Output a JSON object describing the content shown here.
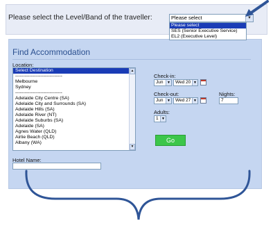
{
  "level": {
    "label": "Please select the Level/Band of the traveller:",
    "selected": "Please select",
    "options": [
      "Please select",
      "SES (Senior Executive Service)",
      "EL2 (Executive Level)"
    ]
  },
  "find": {
    "title": "Find Accommodation",
    "location_label": "Location:",
    "locations": [
      "Select Destination",
      "------------------------------",
      "Melbourne",
      "Sydney",
      "------------------------------",
      "Adelaide City Centre (SA)",
      "Adelaide City and Surrounds (SA)",
      "Adelaide Hills (SA)",
      "Adelaide River (NT)",
      "Adelaide Suburbs (SA)",
      "Adelaide (SA)",
      "Agnes Water (QLD)",
      "Airlie Beach (QLD)",
      "Albany (WA)"
    ],
    "hotel_label": "Hotel Name:",
    "checkin_label": "Check-in:",
    "checkin_month": "Jun",
    "checkin_day": "Wed 20",
    "checkout_label": "Check-out:",
    "checkout_month": "Jun",
    "checkout_day": "Wed 27",
    "nights_label": "Nights:",
    "nights_value": "7",
    "adults_label": "Adults:",
    "adults_value": "1",
    "go_label": "Go"
  },
  "colors": {
    "panel_bg": "#c5d6f1",
    "title": "#2a4f8f",
    "go": "#3cc64a",
    "annotation": "#2f5597"
  },
  "icons": [
    "calendar-icon",
    "dropdown-arrow-icon",
    "pointer-arrow-icon",
    "curly-brace"
  ]
}
